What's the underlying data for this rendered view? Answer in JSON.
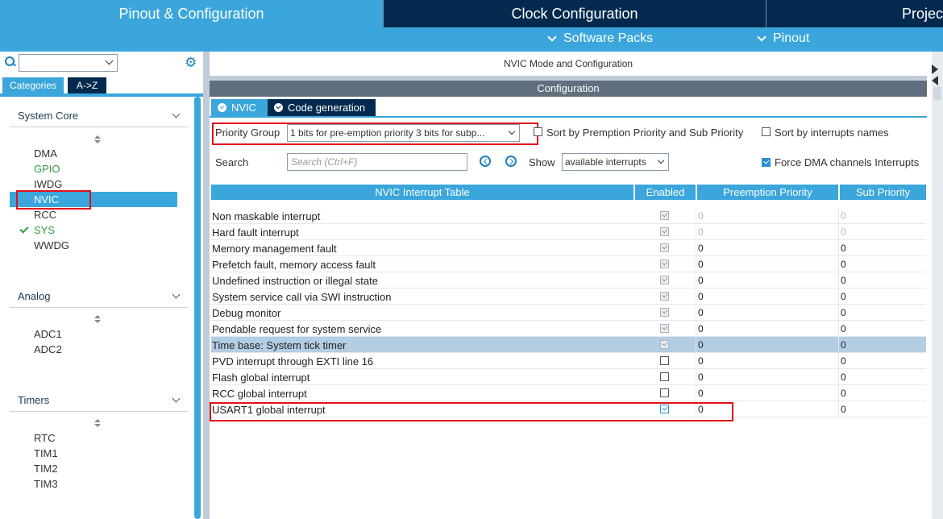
{
  "top_tabs": {
    "pinout": "Pinout & Configuration",
    "clock": "Clock Configuration",
    "project": "Project"
  },
  "sub_menu": {
    "software_packs": "Software Packs",
    "pinout": "Pinout"
  },
  "left": {
    "tab_categories": "Categories",
    "tab_az": "A->Z",
    "sections": [
      {
        "title": "System Core",
        "items": [
          "DMA",
          "GPIO",
          "IWDG",
          "NVIC",
          "RCC",
          "SYS",
          "WWDG"
        ]
      },
      {
        "title": "Analog",
        "items": [
          "ADC1",
          "ADC2"
        ]
      },
      {
        "title": "Timers",
        "items": [
          "RTC",
          "TIM1",
          "TIM2",
          "TIM3"
        ]
      }
    ]
  },
  "main": {
    "mode_title": "NVIC Mode and Configuration",
    "config_title": "Configuration",
    "tab_nvic": "NVIC",
    "tab_codegen": "Code generation",
    "priority_group_label": "Priority Group",
    "priority_group_value": "1 bits for pre-emption priority 3 bits for subp...",
    "sort_premption": "Sort by Premption Priority and Sub Priority",
    "sort_names": "Sort by interrupts names",
    "search_label": "Search",
    "search_placeholder": "Search (Ctrl+F)",
    "show_label": "Show",
    "show_value": "available interrupts",
    "force_dma": "Force DMA channels Interrupts",
    "table": {
      "headers": [
        "NVIC Interrupt Table",
        "Enabled",
        "Preemption Priority",
        "Sub Priority"
      ],
      "rows": [
        {
          "name": "Non maskable interrupt",
          "pre": "0",
          "sub": "0"
        },
        {
          "name": "Hard fault interrupt",
          "pre": "0",
          "sub": "0"
        },
        {
          "name": "Memory management fault",
          "pre": "0",
          "sub": "0"
        },
        {
          "name": "Prefetch fault, memory access fault",
          "pre": "0",
          "sub": "0"
        },
        {
          "name": "Undefined instruction or illegal state",
          "pre": "0",
          "sub": "0"
        },
        {
          "name": "System service call via SWI instruction",
          "pre": "0",
          "sub": "0"
        },
        {
          "name": "Debug monitor",
          "pre": "0",
          "sub": "0"
        },
        {
          "name": "Pendable request for system service",
          "pre": "0",
          "sub": "0"
        },
        {
          "name": "Time base: System tick timer",
          "pre": "0",
          "sub": "0"
        },
        {
          "name": "PVD interrupt through EXTI line 16",
          "pre": "0",
          "sub": "0"
        },
        {
          "name": "Flash global interrupt",
          "pre": "0",
          "sub": "0"
        },
        {
          "name": "RCC global interrupt",
          "pre": "0",
          "sub": "0"
        },
        {
          "name": "USART1 global interrupt",
          "pre": "0",
          "sub": "0"
        }
      ]
    }
  },
  "colors": {
    "accent": "#3aa6dc",
    "dark_tab": "#032a4e",
    "highlight": "#e3101a",
    "green": "#2e9e3e"
  }
}
